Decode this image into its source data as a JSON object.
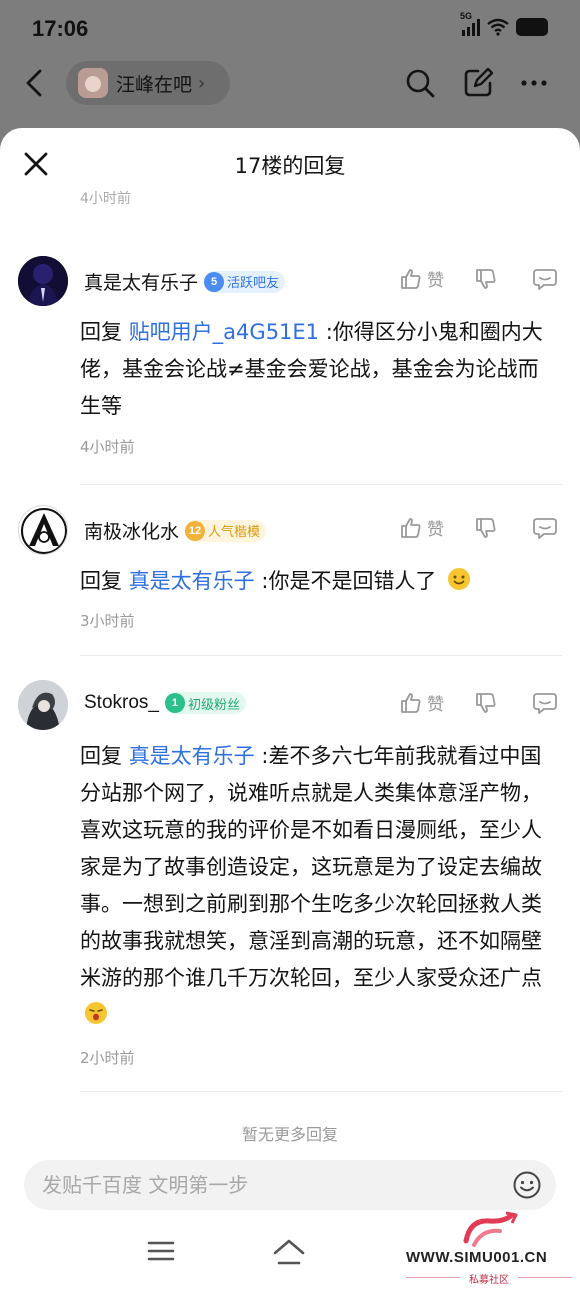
{
  "status_bar": {
    "time": "17:06",
    "network": "5G"
  },
  "topnav": {
    "forum_name": "汪峰在吧"
  },
  "sheet": {
    "title": "17楼的回复",
    "peek_text": "4小时前"
  },
  "replies": [
    {
      "username": "真是太有乐子",
      "level": "5",
      "badge": "活跃吧友",
      "like_label": "赞",
      "prefix": "回复 ",
      "mention": "贴吧用户_a4G51E1",
      "text": " :你得区分小鬼和圈内大佬，基金会论战≠基金会爱论战，基金会为论战而生等",
      "time": "4小时前"
    },
    {
      "username": "南极冰化水",
      "level": "12",
      "badge": "人气楷模",
      "like_label": "赞",
      "prefix": "回复 ",
      "mention": "真是太有乐子",
      "text": " :你是不是回错人了",
      "time": "3小时前"
    },
    {
      "username": "Stokros_",
      "level": "1",
      "badge": "初级粉丝",
      "like_label": "赞",
      "prefix": "回复 ",
      "mention": "真是太有乐子",
      "text": " :差不多六七年前我就看过中国分站那个网了，说难听点就是人类集体意淫产物，喜欢这玩意的我的评价是不如看日漫厕纸，至少人家是为了故事创造设定，这玩意是为了设定去编故事。一想到之前刷到那个生吃多少次轮回拯救人类的故事我就想笑，意淫到高潮的玩意，还不如隔壁米游的那个谁几千万次轮回，至少人家受众还广点",
      "time": "2小时前"
    }
  ],
  "footer": {
    "no_more": "暂无更多回复",
    "input_placeholder": "发贴千百度 文明第一步"
  },
  "watermark": {
    "url": "WWW.SIMU001.CN",
    "subtitle": "私募社区"
  },
  "colors": {
    "mention": "#2f6fe0",
    "overlay": "#7d7d7d",
    "muted": "#9a9a9a"
  }
}
